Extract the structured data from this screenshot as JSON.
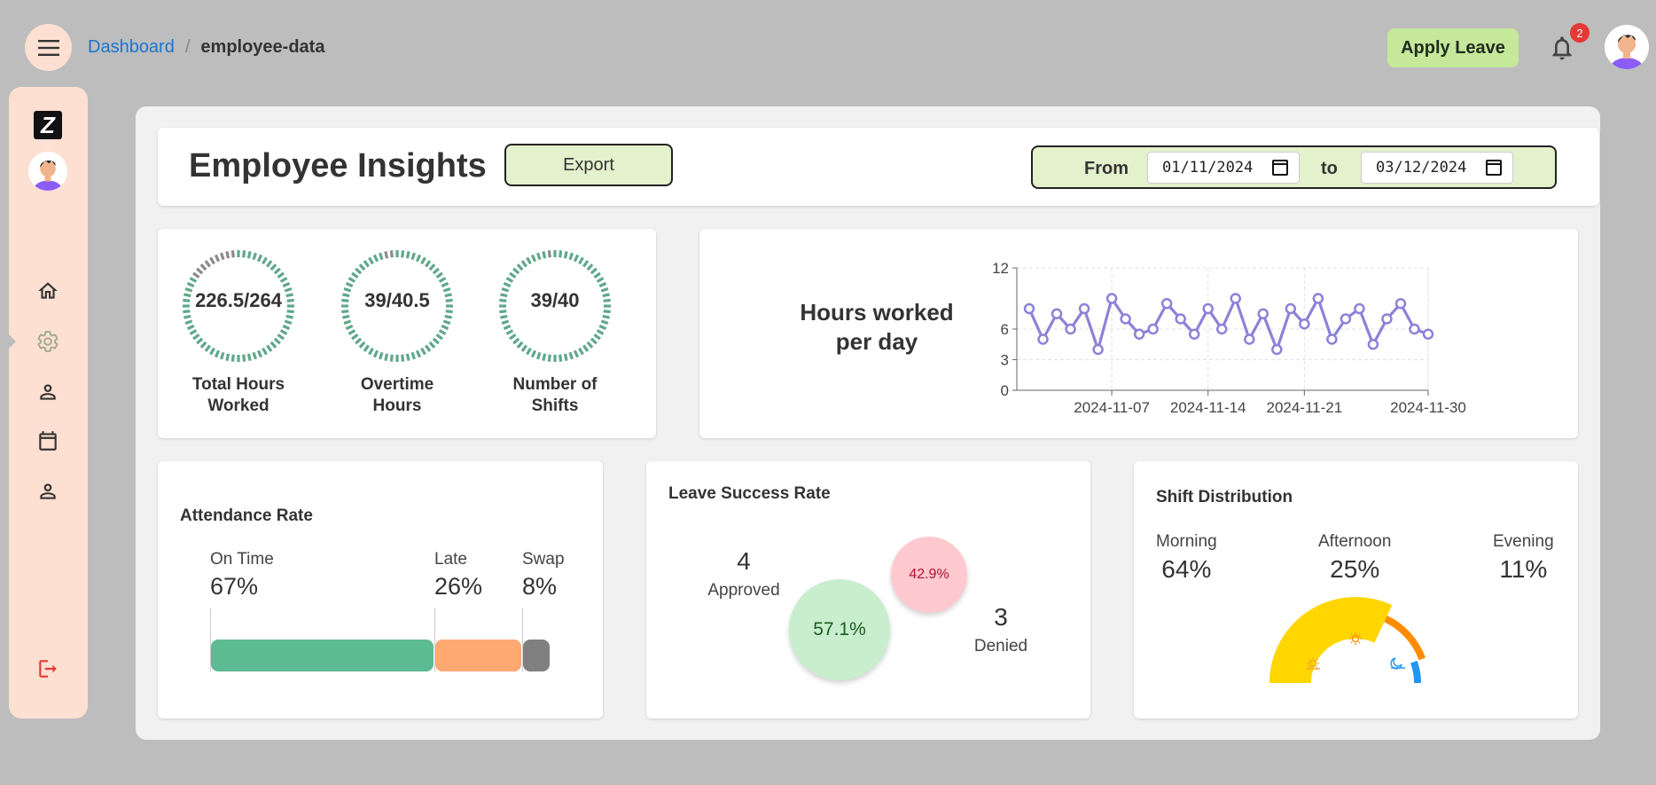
{
  "breadcrumb": {
    "home": "Dashboard",
    "separator": "/",
    "current": "employee-data"
  },
  "header": {
    "apply_leave": "Apply Leave",
    "notification_count": "2"
  },
  "page": {
    "title": "Employee Insights",
    "export_label": "Export"
  },
  "date_range": {
    "from_label": "From",
    "from_value": "01/11/2024",
    "to_label": "to",
    "to_value": "03/12/2024"
  },
  "sidebar": {
    "logo": "Z",
    "items": [
      "home-icon",
      "gear-icon",
      "person-icon",
      "calendar-icon",
      "person-icon",
      "logout-icon"
    ],
    "active": "gear-icon"
  },
  "stats": [
    {
      "value": "226.5/264",
      "label": "Total Hours Worked",
      "fraction": 0.858
    },
    {
      "value": "39/40.5",
      "label": "Overtime Hours",
      "fraction": 0.963
    },
    {
      "value": "39/40",
      "label": "Number of Shifts",
      "fraction": 0.975
    }
  ],
  "hours_chart": {
    "title": "Hours worked per day",
    "chart_data": {
      "type": "line",
      "x": [
        "2024-11-01",
        "2024-11-02",
        "2024-11-03",
        "2024-11-04",
        "2024-11-05",
        "2024-11-06",
        "2024-11-07",
        "2024-11-08",
        "2024-11-09",
        "2024-11-10",
        "2024-11-11",
        "2024-11-12",
        "2024-11-13",
        "2024-11-14",
        "2024-11-15",
        "2024-11-16",
        "2024-11-17",
        "2024-11-18",
        "2024-11-19",
        "2024-11-20",
        "2024-11-21",
        "2024-11-22",
        "2024-11-23",
        "2024-11-24",
        "2024-11-25",
        "2024-11-26",
        "2024-11-27",
        "2024-11-28",
        "2024-11-29",
        "2024-11-30"
      ],
      "values": [
        8,
        5,
        7.5,
        6,
        8,
        4,
        9,
        7,
        5.5,
        6,
        8.5,
        7,
        5.5,
        8,
        6,
        9,
        5,
        7.5,
        4,
        8,
        6.5,
        9,
        5,
        7,
        8,
        4.5,
        7,
        8.5,
        6,
        5.5
      ],
      "ylim": [
        0,
        12
      ],
      "yticks": [
        "0",
        "3",
        "6",
        "12"
      ],
      "xticks": [
        "2024-11-07",
        "2024-11-14",
        "2024-11-21",
        "2024-11-30"
      ],
      "grid": true,
      "color": "#8c82d8"
    }
  },
  "attendance": {
    "title": "Attendance Rate",
    "items": [
      {
        "name": "On Time",
        "pct": "67%",
        "color": "#5dbb91"
      },
      {
        "name": "Late",
        "pct": "26%",
        "color": "#ffa872"
      },
      {
        "name": "Swap",
        "pct": "8%",
        "color": "#808080"
      }
    ]
  },
  "leave": {
    "title": "Leave Success Rate",
    "approved_count": "4",
    "approved_label": "Approved",
    "approved_pct": "57.1%",
    "denied_count": "3",
    "denied_label": "Denied",
    "denied_pct": "42.9%"
  },
  "shift": {
    "title": "Shift Distribution",
    "items": [
      {
        "name": "Morning",
        "pct": "64%",
        "color": "#ffd600"
      },
      {
        "name": "Afternoon",
        "pct": "25%",
        "color": "#ff8c00"
      },
      {
        "name": "Evening",
        "pct": "11%",
        "color": "#2196f3"
      }
    ]
  }
}
